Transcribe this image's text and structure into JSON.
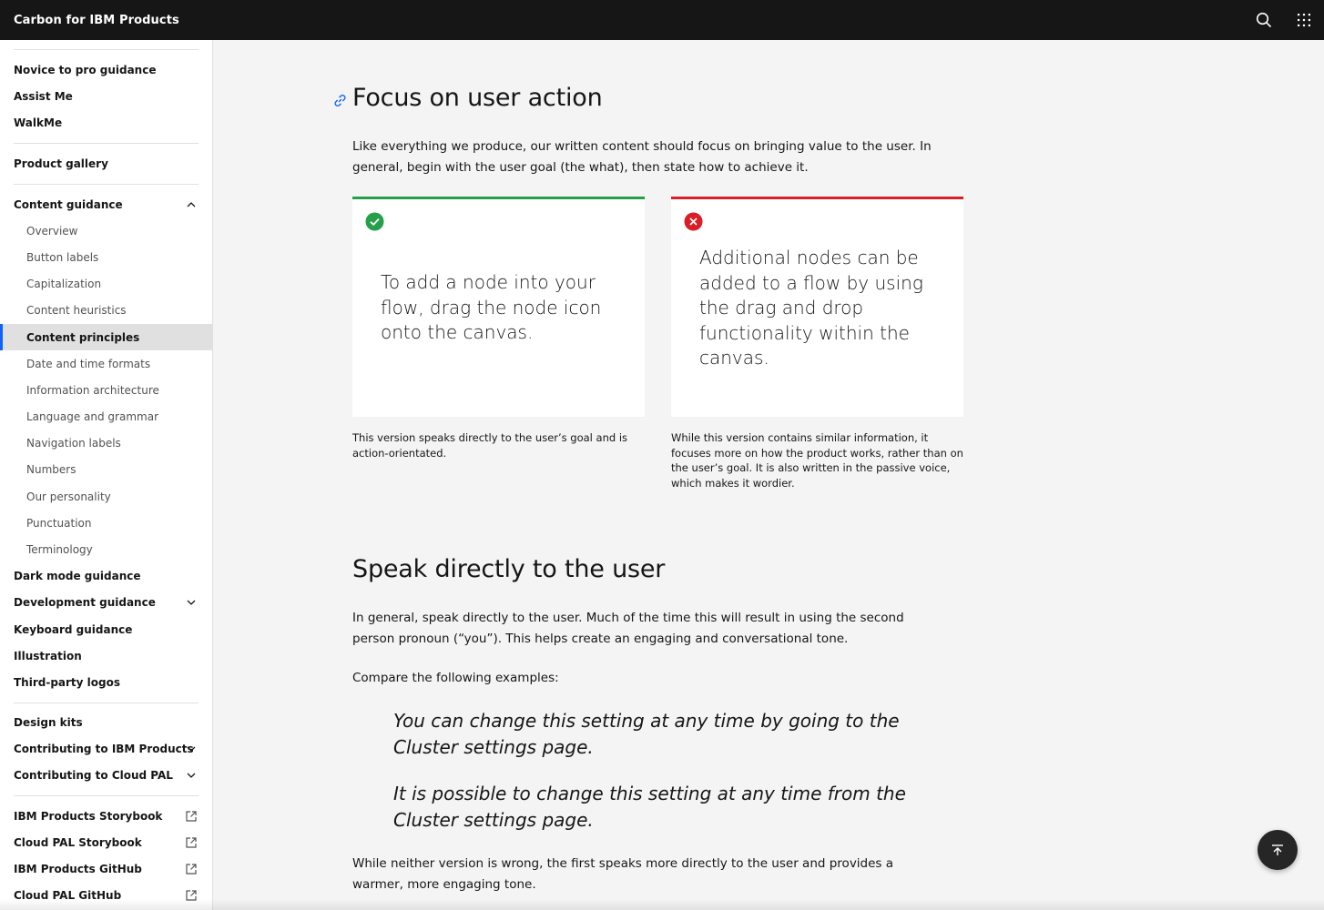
{
  "header": {
    "brand": "Carbon for IBM Products",
    "search_icon": "search-icon",
    "switcher_icon": "app-switcher-icon"
  },
  "sidebar": {
    "items": [
      {
        "label": "Novice to pro guidance"
      },
      {
        "label": "Assist Me"
      },
      {
        "label": "WalkMe"
      },
      {
        "label": "Product gallery"
      },
      {
        "label": "Content guidance"
      },
      {
        "label": "Overview"
      },
      {
        "label": "Button labels"
      },
      {
        "label": "Capitalization"
      },
      {
        "label": "Content heuristics"
      },
      {
        "label": "Content principles"
      },
      {
        "label": "Date and time formats"
      },
      {
        "label": "Information architecture"
      },
      {
        "label": "Language and grammar"
      },
      {
        "label": "Navigation labels"
      },
      {
        "label": "Numbers"
      },
      {
        "label": "Our personality"
      },
      {
        "label": "Punctuation"
      },
      {
        "label": "Terminology"
      },
      {
        "label": "Dark mode guidance"
      },
      {
        "label": "Development guidance"
      },
      {
        "label": "Keyboard guidance"
      },
      {
        "label": "Illustration"
      },
      {
        "label": "Third-party logos"
      },
      {
        "label": "Design kits"
      },
      {
        "label": "Contributing to IBM Products"
      },
      {
        "label": "Contributing to Cloud PAL"
      },
      {
        "label": "IBM Products Storybook"
      },
      {
        "label": "Cloud PAL Storybook"
      },
      {
        "label": "IBM Products GitHub"
      },
      {
        "label": "Cloud PAL GitHub"
      }
    ]
  },
  "content": {
    "section1_title": "Focus on user action",
    "section1_para": "Like everything we produce, our written content should focus on bringing value to the user. In general, begin with the user goal (the what), then state how to achieve it.",
    "do_card_text": "To add a node into your flow, drag the node icon onto the canvas.",
    "dont_card_text": "Additional nodes can be added to a flow by using the drag and drop functionality within the canvas.",
    "do_caption": "This version speaks directly to the user’s goal and is action-orientated.",
    "dont_caption": "While this version contains similar information, it focuses more on how the product works, rather than on the user’s goal. It is also written in the passive voice, which makes it wordier.",
    "section2_title": "Speak directly to the user",
    "section2_para": "In general, speak directly to the user. Much of the time this will result in using the second person pronoun (“you”). This helps create an engaging and conversational tone.",
    "compare_intro": "Compare the following examples:",
    "quote1": "You can change this setting at any time by going to the Cluster settings page.",
    "quote2": "It is possible to change this setting at any time from the Cluster settings page.",
    "closing_para": "While neither version is wrong, the first speaks more directly to the user and provides a warmer, more engaging tone."
  },
  "colors": {
    "accent": "#0f62fe",
    "success": "#24a148",
    "error": "#da1e28",
    "header_bg": "#161616"
  }
}
